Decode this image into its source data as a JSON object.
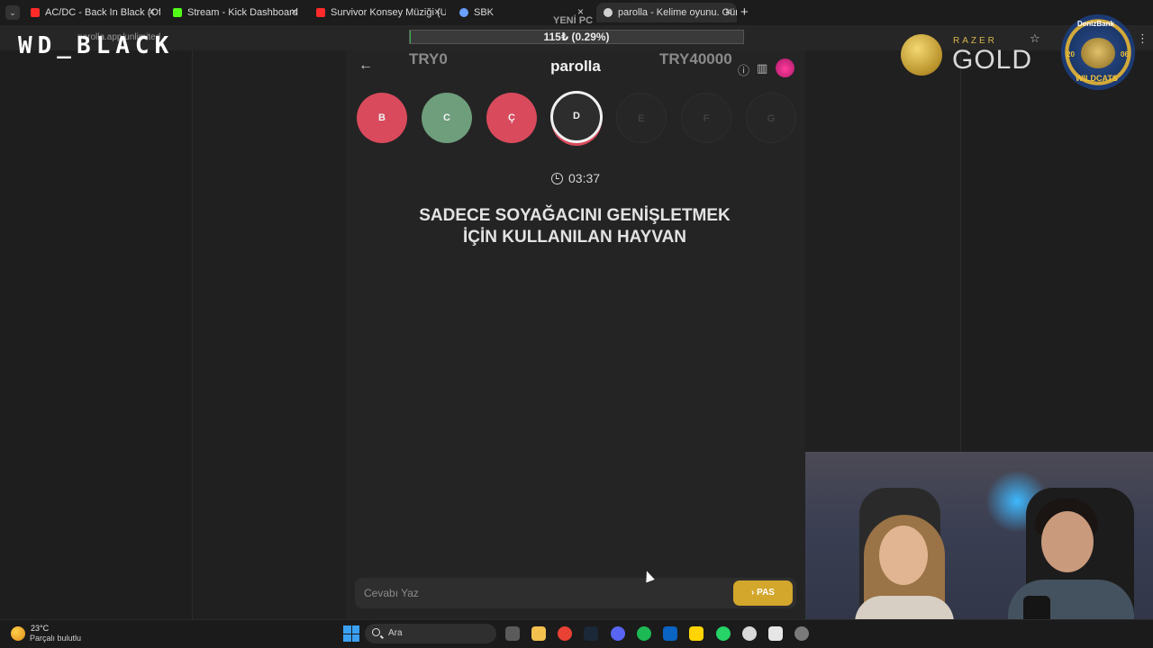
{
  "browser": {
    "tabs": [
      {
        "title": "AC/DC - Back In Black (Official ...",
        "color": "#ff2a2a"
      },
      {
        "title": "Stream - Kick Dashboard",
        "color": "#53fc18"
      },
      {
        "title": "Survivor Konsey Müziği (Uzun V...",
        "color": "#ff2a2a"
      },
      {
        "title": "SBK",
        "color": "#6aa0ff"
      },
      {
        "title": "parolla - Kelime oyunu. Günlük ...",
        "color": "#d0d0d0"
      }
    ],
    "new_tab": "+",
    "url": "parolla.app/unlimited"
  },
  "overlay": {
    "wd_black": "WD_BLACK",
    "yeni_pc": "YENİ PC",
    "progress_label": "115₺ (0.29%)",
    "progress_value": 0.0029,
    "razer": "RAZER",
    "gold": "GOLD",
    "badge_bank": "DenizBank",
    "badge_team": "WILDCATS",
    "badge_year_a": "20",
    "badge_year_b": "06"
  },
  "game": {
    "title": "parolla",
    "try_left": "TRY0",
    "try_right": "TRY40000",
    "info_icon": "info-icon",
    "stats_icon": "bar-chart-icon",
    "letters": [
      {
        "label": "B",
        "state": "wrong"
      },
      {
        "label": "C",
        "state": "correct"
      },
      {
        "label": "Ç",
        "state": "wrong"
      },
      {
        "label": "D",
        "state": "current"
      },
      {
        "label": "E",
        "state": "pending"
      },
      {
        "label": "F",
        "state": "pending"
      },
      {
        "label": "G",
        "state": "pending"
      }
    ],
    "timer": "03:37",
    "question_line1": "SADECE SOYAĞACINI GENİŞLETMEK",
    "question_line2": "İÇİN KULLANILAN HAYVAN",
    "answer_placeholder": "Cevabı Yaz",
    "pass_label": "PAS",
    "colors": {
      "wrong": "#d94a5c",
      "correct": "#6e9e7c",
      "pass": "#d3a72b"
    }
  },
  "taskbar": {
    "temperature": "23°C",
    "weather": "Parçalı bulutlu",
    "search_label": "Ara"
  }
}
